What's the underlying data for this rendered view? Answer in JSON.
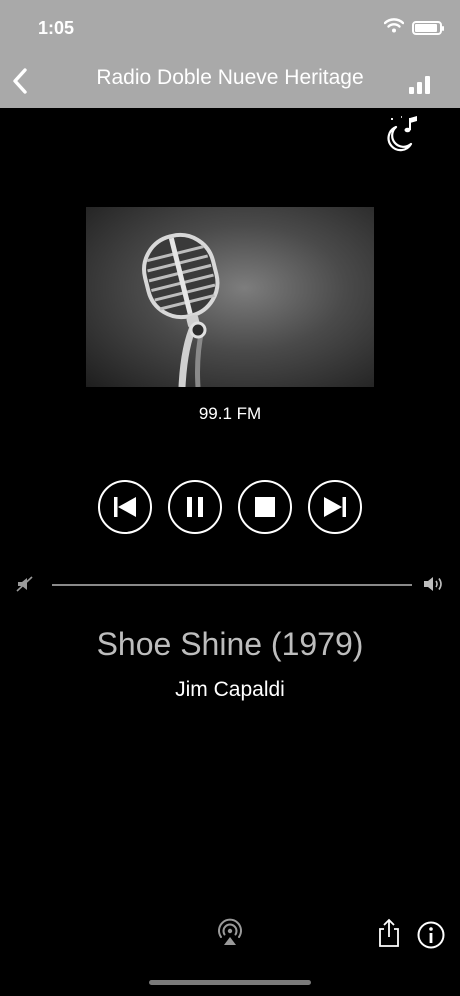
{
  "status_bar": {
    "time": "1:05",
    "wifi_icon": "wifi-icon",
    "battery_icon": "battery-icon",
    "battery_level": 0.9
  },
  "nav": {
    "back_icon": "chevron-left-icon",
    "title": "Radio Doble Nueve Heritage",
    "signal_icon": "signal-bars-icon"
  },
  "toolbar": {
    "sleep_timer_icon": "moon-music-icon"
  },
  "station": {
    "artwork_icon": "microphone-artwork",
    "frequency": "99.1 FM"
  },
  "controls": [
    {
      "name": "previous-button",
      "icon": "skip-back-icon"
    },
    {
      "name": "pause-button",
      "icon": "pause-icon"
    },
    {
      "name": "stop-button",
      "icon": "stop-icon"
    },
    {
      "name": "next-button",
      "icon": "skip-forward-icon"
    }
  ],
  "volume": {
    "min_icon": "volume-mute-icon",
    "max_icon": "volume-up-icon",
    "level": 0
  },
  "now_playing": {
    "title": "Shoe Shine (1979)",
    "artist": "Jim Capaldi"
  },
  "bottom_bar": {
    "airplay_icon": "airplay-icon",
    "share_icon": "share-icon",
    "info_icon": "info-icon"
  },
  "colors": {
    "header_bg": "#a9a9a9",
    "background": "#000000",
    "title_text": "#bdbdbd",
    "foreground": "#ffffff"
  }
}
